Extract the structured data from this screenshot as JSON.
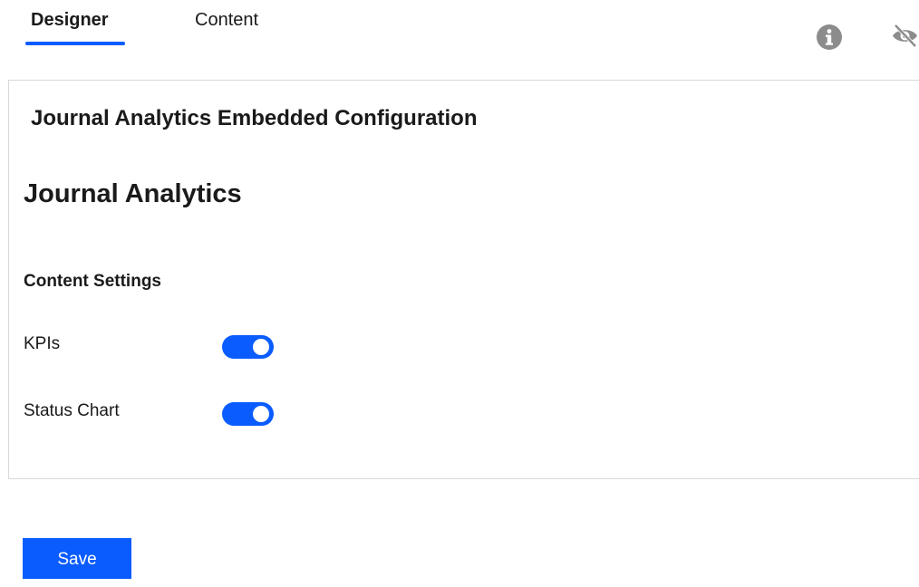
{
  "tabs": [
    {
      "label": "Designer",
      "active": true
    },
    {
      "label": "Content",
      "active": false
    }
  ],
  "header_icons": {
    "info": "info-icon",
    "visibility": "eye-off-icon"
  },
  "config": {
    "title": "Journal Analytics Embedded Configuration",
    "section_title": "Journal Analytics",
    "settings_title": "Content Settings",
    "settings": [
      {
        "label": "KPIs",
        "enabled": true
      },
      {
        "label": "Status Chart",
        "enabled": true
      }
    ]
  },
  "actions": {
    "save_label": "Save"
  },
  "colors": {
    "accent": "#0a5cff",
    "icon_gray": "#8c8c8c",
    "divider": "#d9d9d9"
  }
}
